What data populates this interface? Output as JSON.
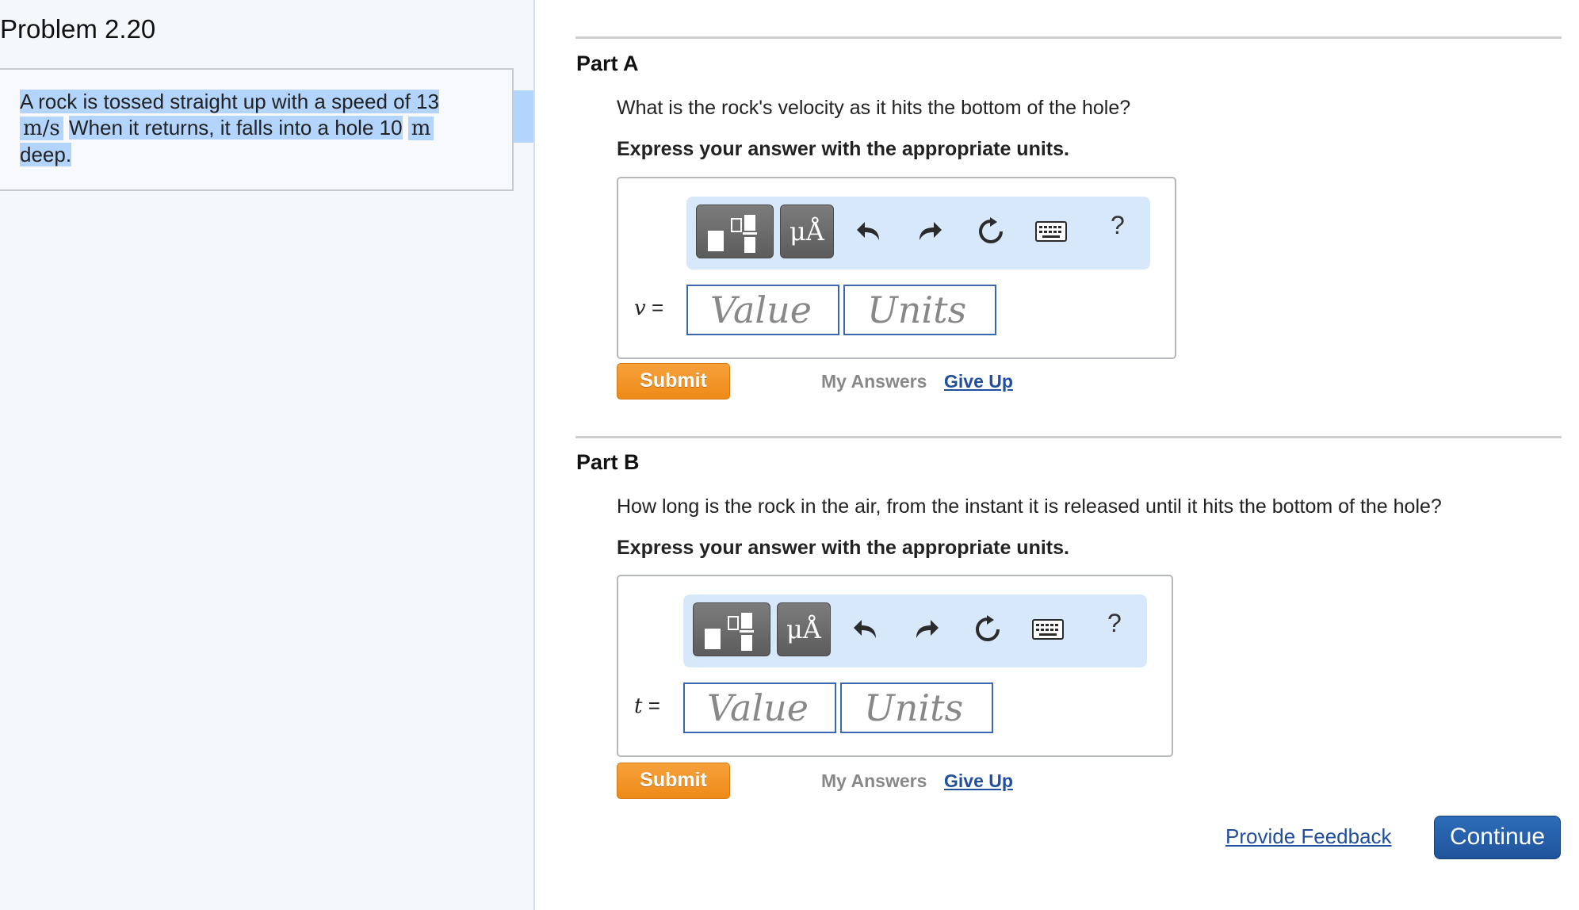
{
  "problem": {
    "title": "Problem 2.20",
    "text_line1": "A rock is tossed straight up with a speed of 13",
    "unit_speed": "m/s",
    "text_line2": "When it returns, it falls into a hole 10",
    "unit_depth": "m",
    "text_line3": "deep."
  },
  "parts": [
    {
      "title": "Part A",
      "question": "What is the rock's velocity as it hits the bottom of the hole?",
      "instruction": "Express your answer with the appropriate units.",
      "variable": "v",
      "equals": "=",
      "value_placeholder": "Value",
      "units_placeholder": "Units",
      "toolbar_mu_label": "μÅ",
      "toolbar_help": "?",
      "submit": "Submit",
      "my_answers": "My Answers",
      "give_up": "Give Up"
    },
    {
      "title": "Part B",
      "question": "How long is the rock in the air, from the instant it is released until it hits the bottom of the hole?",
      "instruction": "Express your answer with the appropriate units.",
      "variable": "t",
      "equals": "=",
      "value_placeholder": "Value",
      "units_placeholder": "Units",
      "toolbar_mu_label": "μÅ",
      "toolbar_help": "?",
      "submit": "Submit",
      "my_answers": "My Answers",
      "give_up": "Give Up"
    }
  ],
  "footer": {
    "feedback": "Provide Feedback",
    "continue": "Continue"
  },
  "colors": {
    "highlight": "#b3d4fc",
    "toolbar_bg": "#d8e8fb",
    "submit_orange": "#f09216",
    "link_blue": "#1f4f9e",
    "continue_blue": "#2660a8"
  },
  "icons": [
    "fraction-template-icon",
    "undo-icon",
    "redo-icon",
    "reset-icon",
    "keyboard-icon"
  ]
}
